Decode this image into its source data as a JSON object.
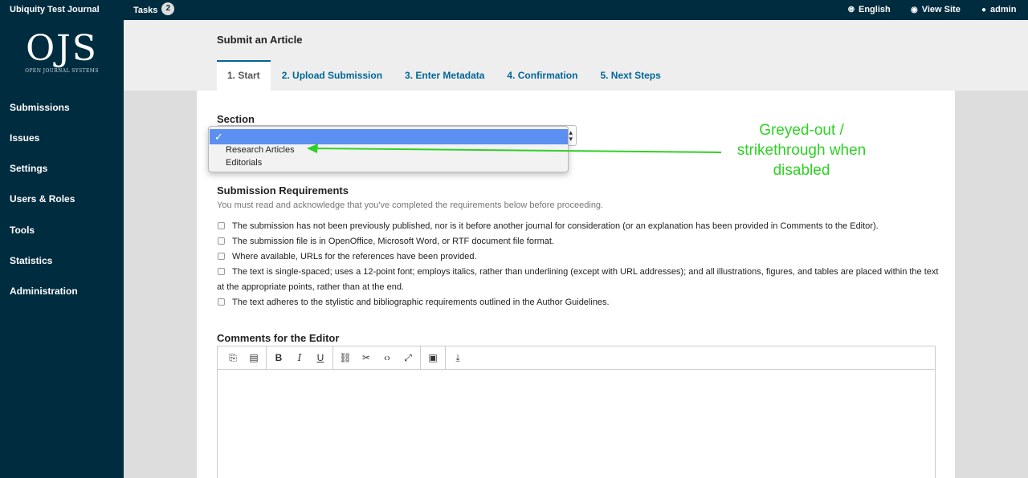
{
  "topbar": {
    "journal_name": "Ubiquity Test Journal",
    "tasks_label": "Tasks",
    "tasks_count": "2",
    "language": "English",
    "view_site": "View Site",
    "user": "admin"
  },
  "logo": {
    "title": "OJS",
    "subtitle": "OPEN JOURNAL SYSTEMS"
  },
  "sidebar": {
    "items": [
      {
        "label": "Submissions"
      },
      {
        "label": "Issues"
      },
      {
        "label": "Settings"
      },
      {
        "label": "Users & Roles"
      },
      {
        "label": "Tools"
      },
      {
        "label": "Statistics"
      },
      {
        "label": "Administration"
      }
    ]
  },
  "page": {
    "title": "Submit an Article",
    "tabs": [
      {
        "label": "1. Start"
      },
      {
        "label": "2. Upload Submission"
      },
      {
        "label": "3. Enter Metadata"
      },
      {
        "label": "4. Confirmation"
      },
      {
        "label": "5. Next Steps"
      }
    ]
  },
  "section": {
    "label": "Section",
    "selected_mark": "✓",
    "options": [
      "Research Articles",
      "Editorials"
    ]
  },
  "annotation": {
    "text": "Greyed-out / strikethrough when disabled",
    "color": "#2fd126"
  },
  "requirements": {
    "heading": "Submission Requirements",
    "note": "You must read and acknowledge that you've completed the requirements below before proceeding.",
    "items": [
      "The submission has not been previously published, nor is it before another journal for consideration (or an explanation has been provided in Comments to the Editor).",
      "The submission file is in OpenOffice, Microsoft Word, or RTF document file format.",
      "Where available, URLs for the references have been provided.",
      "The text is single-spaced; uses a 12-point font; employs italics, rather than underlining (except with URL addresses); and all illustrations, figures, and tables are placed within the text at the appropriate points, rather than at the end.",
      "The text adheres to the stylistic and bibliographic requirements outlined in the Author Guidelines."
    ]
  },
  "comments": {
    "label": "Comments for the Editor",
    "toolbar": [
      "copy-icon",
      "paste-icon",
      "bold-icon",
      "italic-icon",
      "underline-icon",
      "link-icon",
      "unlink-icon",
      "code-icon",
      "fullscreen-icon",
      "image-icon",
      "upload-icon"
    ]
  },
  "colors": {
    "nav_bg": "#002c40",
    "link": "#006798",
    "highlight": "#5b8ff2"
  }
}
